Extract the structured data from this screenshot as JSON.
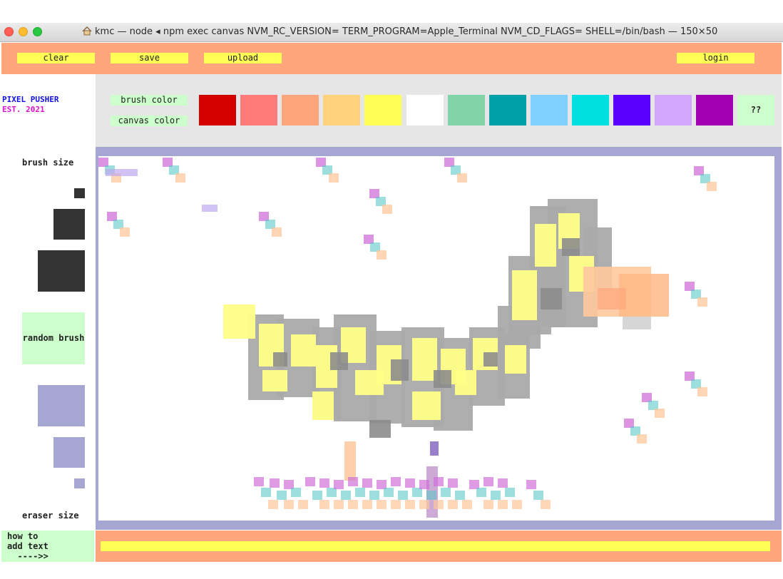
{
  "window": {
    "title": "kmc — node ◂ npm exec canvas NVM_RC_VERSION= TERM_PROGRAM=Apple_Terminal NVM_CD_FLAGS= SHELL=/bin/bash — 150×50",
    "traffic_lights": {
      "close": "#ff5f57",
      "minimize": "#febc2e",
      "zoom": "#28c840"
    }
  },
  "toolbar": {
    "clear_label": "clear",
    "save_label": "save",
    "upload_label": "upload",
    "login_label": "login"
  },
  "logo": {
    "line1": "PIXEL PUSHER",
    "line2": "EST. 2021"
  },
  "palette": {
    "brush_color_label": "brush color",
    "canvas_color_label": "canvas color",
    "swatches": [
      "#d50000",
      "#ff7b7b",
      "#ffa67c",
      "#ffd27c",
      "#ffff55",
      "#ffffff",
      "#80d4a8",
      "#00a0a8",
      "#80d0ff",
      "#00e0e0",
      "#5a00ff",
      "#d2a8ff",
      "#a000b0"
    ],
    "mystery_label": "??"
  },
  "sidebar": {
    "brush_size_label": "brush size",
    "random_brush_label": "random brush",
    "eraser_size_label": "eraser size"
  },
  "text_tool": {
    "howto_line1": "how to",
    "howto_line2": "add text",
    "howto_line3": "  ---->>",
    "input_value": ""
  }
}
